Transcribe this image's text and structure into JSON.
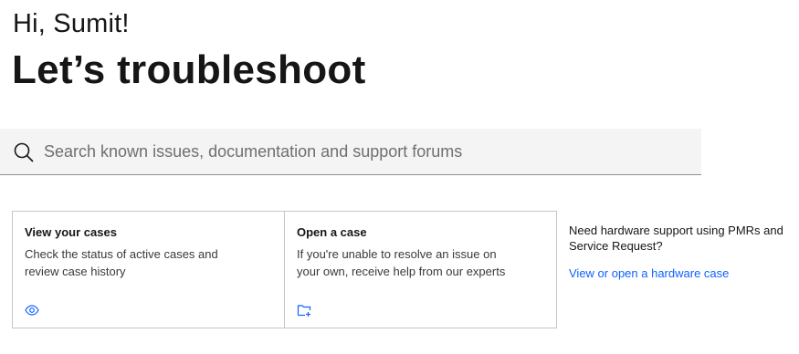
{
  "greeting": "Hi, Sumit!",
  "headline": "Let’s troubleshoot",
  "search": {
    "placeholder": "Search known issues, documentation and support forums",
    "value": ""
  },
  "cards": [
    {
      "title": "View your cases",
      "description": "Check the status of active cases and review case history",
      "icon": "eye-icon"
    },
    {
      "title": "Open a case",
      "description": "If you're unable to resolve an issue on your own, receive help from our experts",
      "icon": "folder-add-icon"
    }
  ],
  "hardware": {
    "text": "Need hardware support using PMRs and Service Request?",
    "link": "View or open a hardware case"
  },
  "colors": {
    "accent": "#0f62fe",
    "text": "#161616",
    "search_bg": "#f4f4f4",
    "border": "#c6c6c6"
  }
}
